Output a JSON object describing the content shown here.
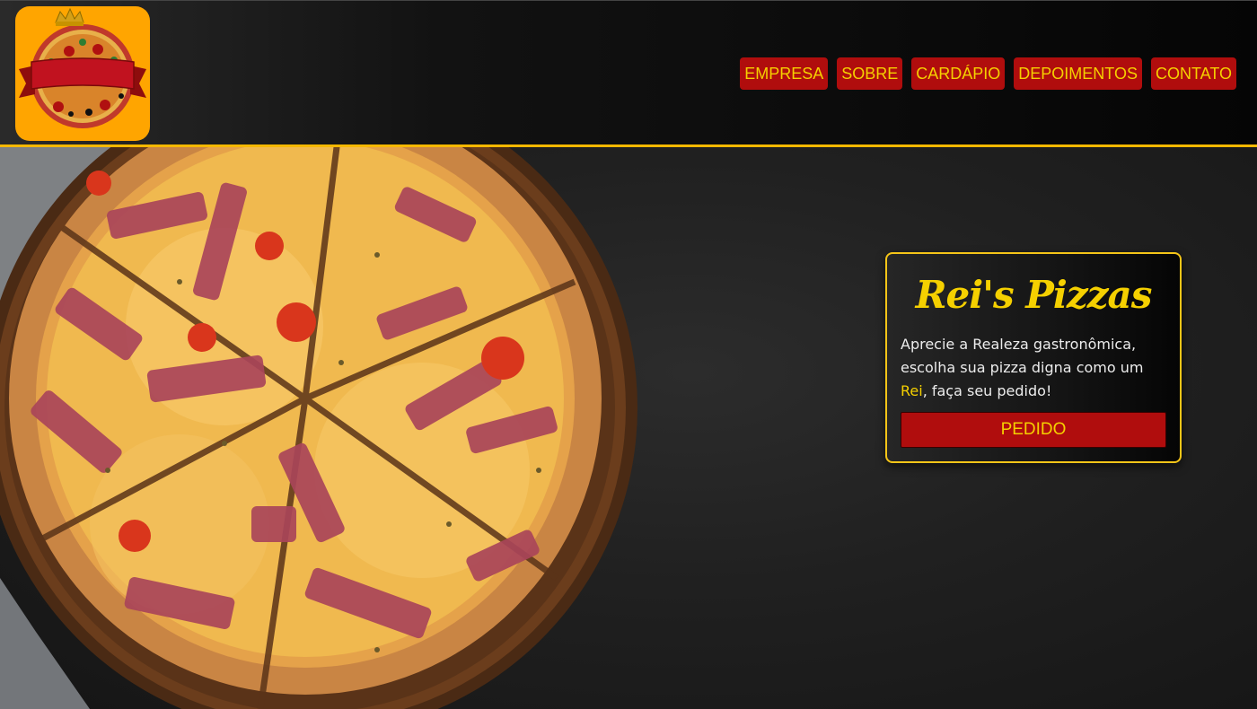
{
  "header": {
    "logo_text": "Rei's Pizzas",
    "nav": [
      {
        "label": "EMPRESA"
      },
      {
        "label": "SOBRE"
      },
      {
        "label": "CARDÁPIO"
      },
      {
        "label": "DEPOIMENTOS"
      },
      {
        "label": "CONTATO"
      }
    ]
  },
  "hero": {
    "card": {
      "title": "Rei's Pizzas",
      "text_before": "Aprecie a Realeza gastronômica, escolha sua pizza digna como um ",
      "text_highlight": "Rei",
      "text_after": ", faça seu pedido!",
      "button_label": "PEDIDO"
    }
  },
  "colors": {
    "accent_yellow": "#f5d000",
    "button_red": "#b00d0d",
    "header_border": "#f5b800",
    "logo_bg": "#ffa500"
  }
}
